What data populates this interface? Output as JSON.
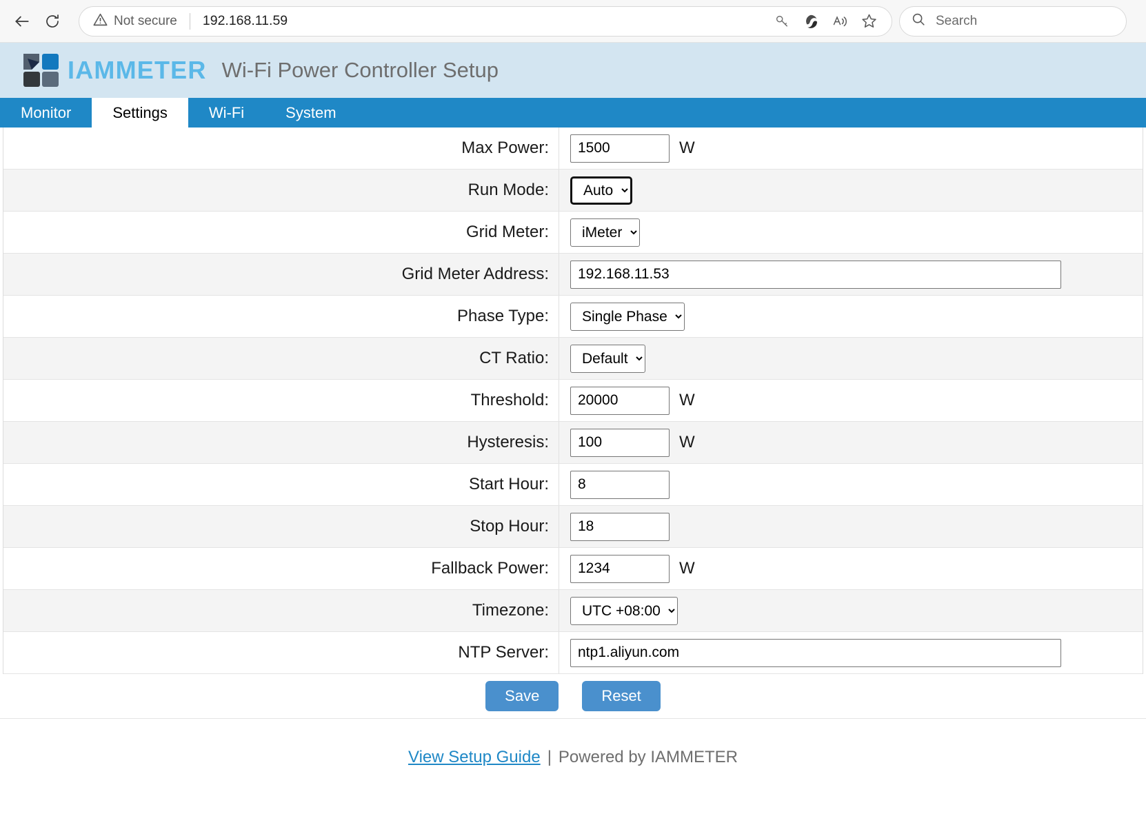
{
  "browser": {
    "back_icon": "back-arrow-icon",
    "reload_icon": "reload-icon",
    "security_label": "Not secure",
    "url": "192.168.11.59",
    "toolbar_icons": [
      "key-icon",
      "copilot-icon",
      "read-aloud-icon",
      "favorite-star-icon"
    ],
    "search_placeholder": "Search"
  },
  "header": {
    "brand": "IAMMETER",
    "title": "Wi-Fi Power Controller Setup",
    "bg_color": "#d3e5f1",
    "brand_color": "#5bb8e8"
  },
  "tabs": [
    {
      "label": "Monitor",
      "active": false
    },
    {
      "label": "Settings",
      "active": true
    },
    {
      "label": "Wi-Fi",
      "active": false
    },
    {
      "label": "System",
      "active": false
    }
  ],
  "tab_bar_color": "#1f88c6",
  "form": {
    "rows": [
      {
        "label": "Max Power:",
        "type": "text",
        "value": "1500",
        "unit": "W"
      },
      {
        "label": "Run Mode:",
        "type": "select",
        "value": "Auto",
        "unit": "",
        "focused": true
      },
      {
        "label": "Grid Meter:",
        "type": "select",
        "value": "iMeter",
        "unit": ""
      },
      {
        "label": "Grid Meter Address:",
        "type": "text",
        "value": "192.168.11.53",
        "unit": "",
        "wide": true
      },
      {
        "label": "Phase Type:",
        "type": "select",
        "value": "Single Phase",
        "unit": ""
      },
      {
        "label": "CT Ratio:",
        "type": "select",
        "value": "Default",
        "unit": ""
      },
      {
        "label": "Threshold:",
        "type": "text",
        "value": "20000",
        "unit": "W"
      },
      {
        "label": "Hysteresis:",
        "type": "text",
        "value": "100",
        "unit": "W"
      },
      {
        "label": "Start Hour:",
        "type": "text",
        "value": "8",
        "unit": ""
      },
      {
        "label": "Stop Hour:",
        "type": "text",
        "value": "18",
        "unit": ""
      },
      {
        "label": "Fallback Power:",
        "type": "text",
        "value": "1234",
        "unit": "W"
      },
      {
        "label": "Timezone:",
        "type": "select",
        "value": "UTC +08:00",
        "unit": ""
      },
      {
        "label": "NTP Server:",
        "type": "text",
        "value": "ntp1.aliyun.com",
        "unit": "",
        "wide": true
      }
    ]
  },
  "actions": {
    "save_label": "Save",
    "reset_label": "Reset",
    "button_color": "#4a90cd"
  },
  "footer": {
    "link_label": "View Setup Guide",
    "separator": "|",
    "powered_by": "Powered by IAMMETER"
  }
}
